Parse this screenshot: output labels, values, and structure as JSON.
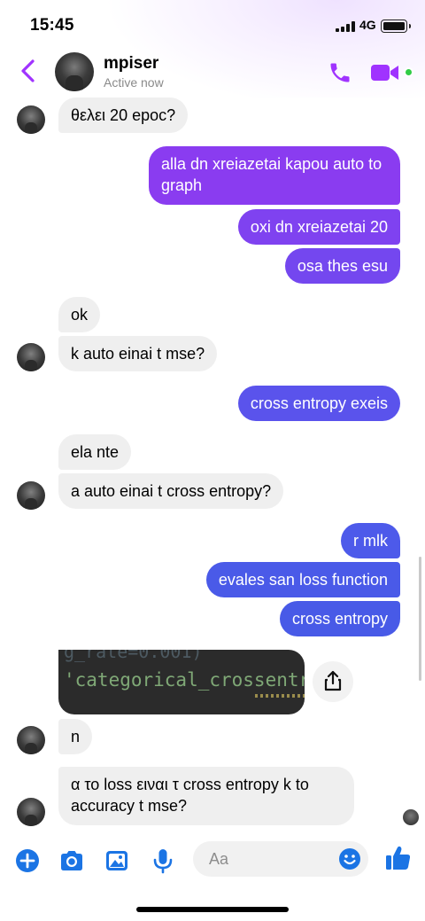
{
  "status_bar": {
    "time": "15:45",
    "network": "4G"
  },
  "header": {
    "contact_name": "mpiser",
    "contact_status": "Active now"
  },
  "messages": [
    {
      "dir": "in",
      "text": "θελει 20 epoc?"
    },
    {
      "dir": "out",
      "text": "alla dn xreiazetai kapou auto to graph"
    },
    {
      "dir": "out",
      "text": "oxi dn xreiazetai 20"
    },
    {
      "dir": "out",
      "text": "osa thes esu"
    },
    {
      "dir": "in",
      "text": "ok"
    },
    {
      "dir": "in",
      "text": "k auto einai t mse?"
    },
    {
      "dir": "out",
      "text": "cross entropy exeis"
    },
    {
      "dir": "in",
      "text": "ela nte"
    },
    {
      "dir": "in",
      "text": "a auto einai t cross entropy?"
    },
    {
      "dir": "out",
      "text": "r mlk"
    },
    {
      "dir": "out",
      "text": "evales san loss function"
    },
    {
      "dir": "out",
      "text": "cross entropy"
    },
    {
      "dir": "in",
      "type": "image",
      "code_top": "g_rate=0.001)",
      "code_main": "'categorical_crossentr"
    },
    {
      "dir": "in",
      "text": "n"
    },
    {
      "dir": "in",
      "text": "α το loss ειναι τ cross entropy k to accuracy t mse?"
    }
  ],
  "composer": {
    "placeholder": "Aa"
  },
  "icons": {
    "back": "chevron-left-icon",
    "phone": "phone-icon",
    "video": "video-camera-icon",
    "plus": "plus-circle-icon",
    "camera": "camera-icon",
    "gallery": "image-icon",
    "mic": "microphone-icon",
    "emoji": "smiley-icon",
    "like": "thumbs-up-icon",
    "share": "share-icon"
  },
  "colors": {
    "accent": "#a033ff",
    "bubble_out_purple": "#8a3cf0",
    "bubble_out_blue": "#4a5ae8",
    "bubble_in": "#efefef",
    "composer_blue": "#1b74e4",
    "online": "#31cc46"
  }
}
